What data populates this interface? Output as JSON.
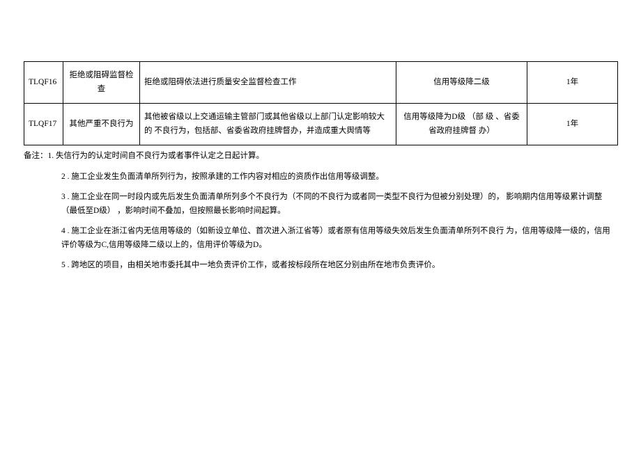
{
  "table": {
    "rows": [
      {
        "code": "TLQF16",
        "category": "拒绝或阻碍监督检查",
        "description": "拒绝或阻碍依法进行质量安全监督检查工作",
        "grade": "信用等级降二级",
        "duration": "1年"
      },
      {
        "code": "TLQF17",
        "category": "其他严重不良行为",
        "description": "其他被省级以上交通运输主管部门或其他省级以上部门认定影响较大的  不良行为，包括部、省委省政府挂牌督办，并造成重大舆情等",
        "grade": "信用等级降为D级 （部   级 、省委省政府挂牌督    办）",
        "duration": "1年"
      }
    ]
  },
  "notes": {
    "prefix": "备注：",
    "items": [
      "1. 失信行为的认定时间自不良行为或者事件认定之日起计算。",
      "2 . 施工企业发生负面清单所列行为，按照承建的工作内容对相应的资质作出信用等级调整。",
      "3 . 施工企业在同一时段内或先后发生负面清单所列多个不良行为（不同的不良行为或者同一类型不良行为但被分别处理）的，  影响期内信用等级累计调整（最低至D级） ，影响时间不叠加，但按照最长影响时间起算。",
      "4  . 施工企业在浙江省内无信用等级的（如新设立单位、首次进入浙江省等）或者原有信用等级失效后发生负面清单所列不良行  为，信用等级降一级的，信用评价等级为C,信用等级降二级以上的，信用评价等级为D。",
      "5  . 跨地区的项目，由相关地市委托其中一地负责评价工作，或者按标段所在地区分别由所在地市负责评价。"
    ]
  }
}
